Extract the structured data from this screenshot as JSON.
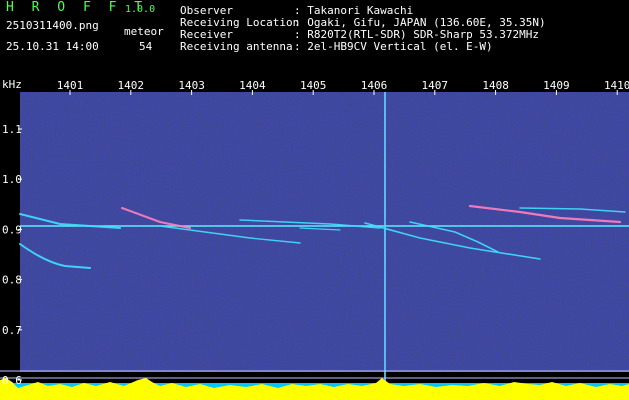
{
  "app": {
    "name": "H R O F F T",
    "version": "1.0.0",
    "filename": "2510311400.png",
    "timestamp": "25.10.31 14:00",
    "meteor_label": "meteor",
    "meteor_count": "54"
  },
  "info": [
    {
      "label": "Observer",
      "value": ": Takanori Kawachi"
    },
    {
      "label": "Receiving Location",
      "value": ": Ogaki, Gifu, JAPAN (136.60E, 35.35N)"
    },
    {
      "label": "Receiver",
      "value": ": R820T2(RTL-SDR) SDR-Sharp 53.372MHz"
    },
    {
      "label": "Receiving antenna",
      "value": ": 2el-HB9CV Vertical (el. E-W)"
    }
  ],
  "x_axis": {
    "unit": "kHz",
    "ticks": [
      "1401",
      "1402",
      "1403",
      "1404",
      "1405",
      "1406",
      "1407",
      "1408",
      "1409",
      "1410"
    ]
  },
  "y_axis": {
    "ticks": [
      "1.1",
      "1.0",
      "0.9",
      "0.8",
      "0.7",
      "0.6"
    ]
  },
  "colors": {
    "background": "#0a0a4a",
    "accent_green": "#4cff4c",
    "trace_cyan": "#40e0ff",
    "histogram_yellow": "#ffff00"
  }
}
